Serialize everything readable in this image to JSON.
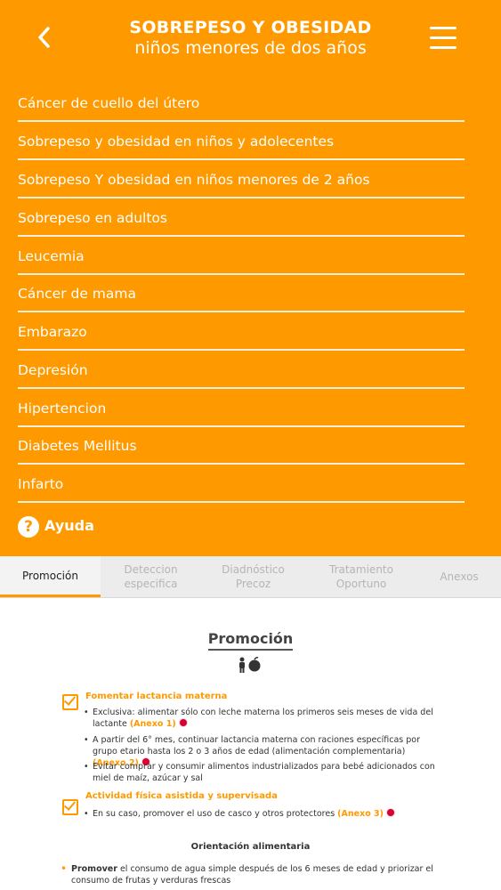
{
  "header": {
    "title_line1": "SOBREPESO Y OBESIDAD",
    "title_line2": "niños menores de dos años",
    "back_icon": "chevron-left-icon",
    "menu_icon": "hamburger-menu-icon"
  },
  "menu": {
    "items": [
      "Cáncer de cuello del útero",
      "Sobrepeso y obesidad en niños y adolecentes",
      "Sobrepeso Y obesidad en niños menores de 2 años",
      "Sobrepeso en adultos",
      "Leucemia",
      "Cáncer de mama",
      "Embarazo",
      "Depresión",
      "Hipertencion",
      "Diabetes Mellitus",
      "Infarto"
    ],
    "help_label": "Ayuda"
  },
  "tabs": [
    {
      "line1": "Promoción",
      "line2": ""
    },
    {
      "line1": "Deteccion",
      "line2": "especifica"
    },
    {
      "line1": "Diadnóstico",
      "line2": "Precoz"
    },
    {
      "line1": "Tratamiento",
      "line2": "Oportuno"
    },
    {
      "line1": "Anexos",
      "line2": ""
    }
  ],
  "content": {
    "heading": "Promoción",
    "section1": {
      "title": "Fomentar lactancia materna",
      "bullets": [
        {
          "text": "Exclusiva: alimentar sólo con leche materna los primeros seis meses de vida del lactante ",
          "anexo": "(Anexo 1)"
        },
        {
          "text": "A partir del 6° mes, continuar lactancia materna con raciones específicas por grupo etario hasta los 2 o 3 años de edad (alimentación complementaria) ",
          "anexo": "(Anexo 2)"
        },
        {
          "text": "Evitar comprar y consumir alimentos industrializados para bebé adicionados con miel de maíz, azúcar y sal",
          "anexo": ""
        }
      ]
    },
    "section2": {
      "title": "Actividad física asistida y supervisada",
      "bullets": [
        {
          "text": "En su caso, promover el uso de casco y otros protectores ",
          "anexo": "(Anexo 3)"
        }
      ]
    },
    "orientation_title": "Orientación alimentaria",
    "promo_bold": "Promover",
    "promo_text": " el consumo de agua simple después de los 6 meses de edad y priorizar el consumo de frutas y verduras frescas"
  },
  "colors": {
    "accent": "#ff9900",
    "marker": "#d60032"
  }
}
